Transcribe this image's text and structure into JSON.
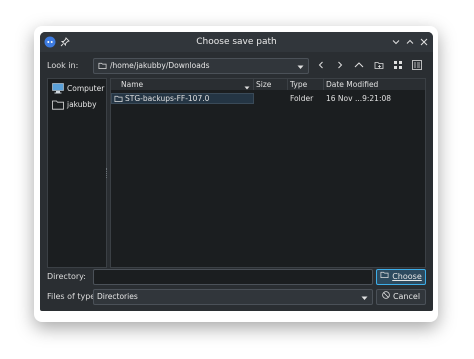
{
  "window": {
    "title": "Choose save path"
  },
  "look_in": {
    "label": "Look in:",
    "path": "/home/jakubby/Downloads"
  },
  "sidebar": {
    "items": [
      {
        "label": "Computer",
        "icon": "computer-icon"
      },
      {
        "label": "jakubby",
        "icon": "folder-icon"
      }
    ]
  },
  "file_list": {
    "columns": [
      "Name",
      "Size",
      "Type",
      "Date Modified"
    ],
    "rows": [
      {
        "name": "STG-backups-FF-107.0",
        "size": "",
        "type": "Folder",
        "date": "16 Nov ...9:21:08"
      }
    ]
  },
  "directory": {
    "label": "Directory:",
    "value": ""
  },
  "files_of_type": {
    "label": "Files of type:",
    "value": "Directories"
  },
  "buttons": {
    "choose": "Choose",
    "cancel": "Cancel"
  },
  "colors": {
    "accent": "#3daee9",
    "window_bg": "#2a2e32",
    "view_bg": "#1b1e20"
  }
}
